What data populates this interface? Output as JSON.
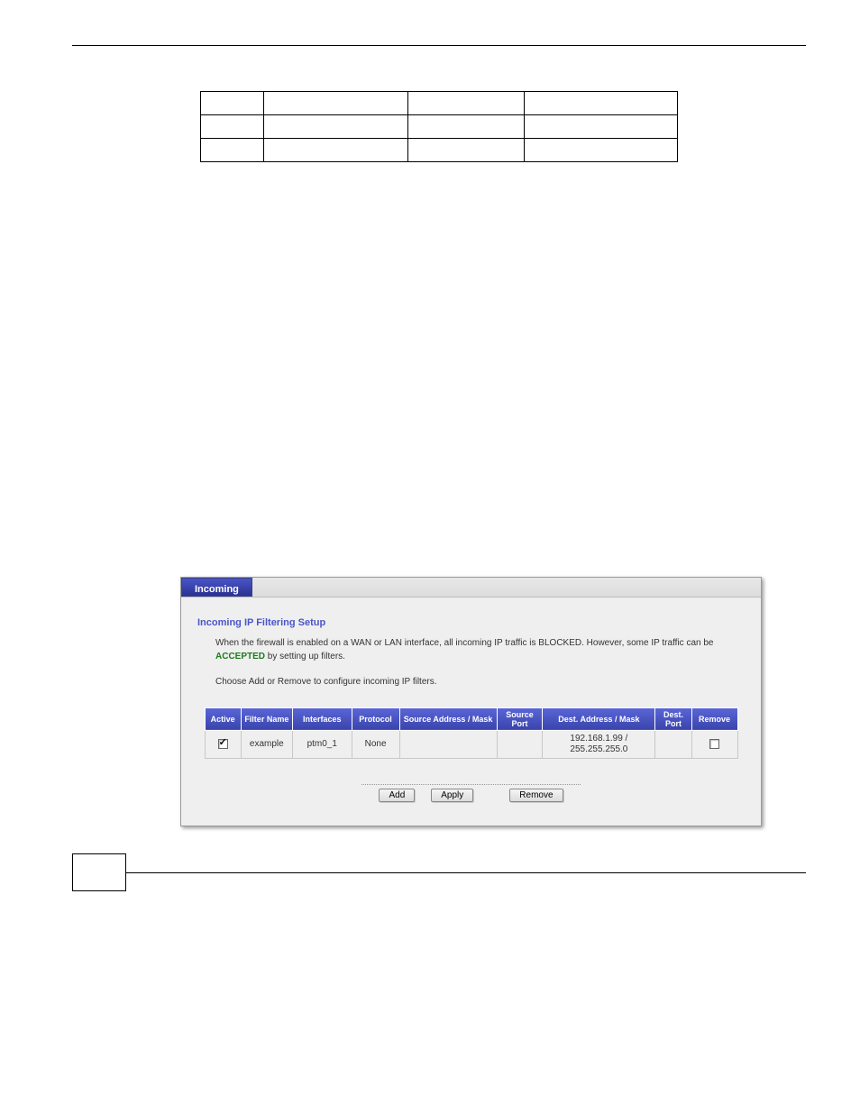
{
  "screenshot": {
    "tab": "Incoming",
    "sectionTitle": "Incoming IP Filtering Setup",
    "desc1a": "When the firewall is enabled on a WAN or LAN interface, all incoming IP traffic is BLOCKED. However, some IP traffic can be ",
    "accepted": "ACCEPTED",
    "desc1b": " by setting up filters.",
    "desc2": "Choose Add or Remove to configure incoming IP filters.",
    "headers": {
      "active": "Active",
      "filterName": "Filter Name",
      "interfaces": "Interfaces",
      "protocol": "Protocol",
      "srcAddr": "Source Address / Mask",
      "srcPort": "Source Port",
      "dstAddr": "Dest. Address / Mask",
      "dstPort": "Dest. Port",
      "remove": "Remove"
    },
    "row": {
      "filterName": "example",
      "interfaces": "ptm0_1",
      "protocol": "None",
      "srcAddr": "",
      "srcPort": "",
      "dstAddr": "192.168.1.99 / 255.255.255.0",
      "dstPort": ""
    },
    "buttons": {
      "add": "Add",
      "apply": "Apply",
      "remove": "Remove"
    }
  }
}
